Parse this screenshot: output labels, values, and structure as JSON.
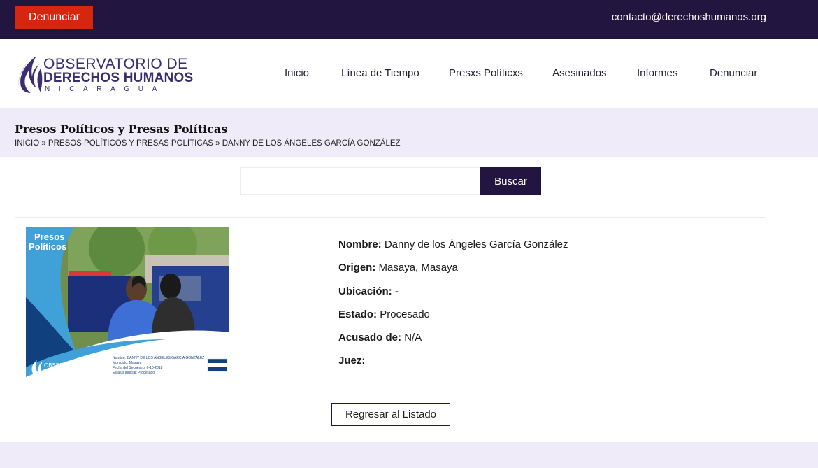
{
  "topbar": {
    "report_button": "Denunciar",
    "contact_email": "contacto@derechoshumanos.org"
  },
  "logo": {
    "line1": "OBSERVATORIO DE",
    "line2": "DERECHOS HUMANOS",
    "line3": "NICARAGUA"
  },
  "nav": {
    "items": [
      "Inicio",
      "Línea de Tiempo",
      "Presxs Políticxs",
      "Asesinados",
      "Informes",
      "Denunciar"
    ]
  },
  "page": {
    "title": "Presos Políticos y Presas Políticas",
    "breadcrumb": "INICIO » PRESOS POLÍTICOS Y PRESAS POLÍTICAS » DANNY DE LOS ÁNGELES GARCÍA GONZÁLEZ"
  },
  "search": {
    "value": "",
    "button": "Buscar"
  },
  "photo": {
    "badge_line1": "Presos",
    "badge_line2": "Políticos",
    "caption_line1": "Nombre: DANNY DE LOS ÁNGELES GARCÍA GONZÁLEZ",
    "caption_line2": "Municipio: Masaya",
    "caption_line3": "Fecha del Secuestro: 6-10-2018",
    "caption_line4": "Estatus judicial: Procesado",
    "logo_line1": "OBSERVATORIO DE",
    "logo_line2": "DERECHOS HUMANOS",
    "logo_line3": "NICARAGUA",
    "colors": {
      "sky": "#3fa1d8",
      "navy": "#10407e",
      "white": "#ffffff"
    }
  },
  "details": [
    {
      "label": "Nombre:",
      "value": "Danny de los Ángeles García González"
    },
    {
      "label": "Origen:",
      "value": "Masaya, Masaya"
    },
    {
      "label": "Ubicación:",
      "value": "-"
    },
    {
      "label": "Estado:",
      "value": "Procesado"
    },
    {
      "label": "Acusado de:",
      "value": "N/A"
    },
    {
      "label": "Juez:",
      "value": ""
    }
  ],
  "back_button": "Regresar al Listado",
  "colors": {
    "primary": "#221540",
    "accent": "#d7260f",
    "band": "#efebf8"
  }
}
